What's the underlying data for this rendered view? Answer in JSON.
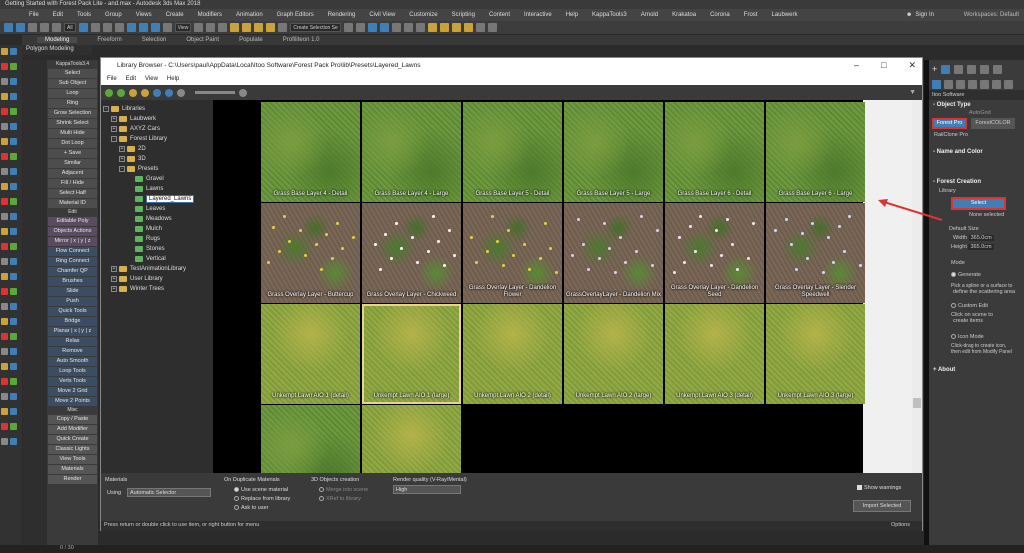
{
  "app": {
    "window_title": "Getting Started with Forest Pack Lite - and.max - Autodesk 3ds Max 2018",
    "menu": [
      "File",
      "Edit",
      "Tools",
      "Group",
      "Views",
      "Create",
      "Modifiers",
      "Animation",
      "Graph Editors",
      "Rendering",
      "Civil View",
      "Customize",
      "Scripting",
      "Content",
      "Interactive",
      "Help",
      "KappaTools3",
      "Arnold",
      "Krakatoa",
      "Corona",
      "Frost",
      "Laubwerk"
    ],
    "sign_in": "Sign In",
    "workspaces": "Workspaces: Default",
    "toolbar": {
      "filter": "All",
      "view": "View",
      "selection_set": "Create Selection Se"
    },
    "ribbon_tabs": [
      "Modeling",
      "Freeform",
      "Selection",
      "Object Paint",
      "Populate",
      "Profiliteon 1.0"
    ],
    "poly_tab": "Polygon Modeling"
  },
  "kappa": {
    "title": "KappaTools3.4",
    "buttons": [
      "Select",
      "Sub Object",
      "Loop",
      "Ring",
      "Grow Selection",
      "Shrink Select",
      "Multi Hide",
      "Dot Loop",
      "+ Save",
      "Similar",
      "Adjacent",
      "Fill / Hide",
      "Select Half",
      "Material ID",
      "Edit",
      "Editable Poly",
      "Objects Actions",
      "Mirror | x | y | z",
      "Flow Connect",
      "Ring Connect",
      "Chamfer QP",
      "Brushes",
      "Slide",
      "Push",
      "Quick Tools",
      "Bridge",
      "Planar | x | y | z",
      "Relax",
      "Remove",
      "Auto Smooth",
      "Loop Tools",
      "Verts Tools",
      "Move 2 Grid",
      "Move 2 Points",
      "Misc",
      "Copy / Paste",
      "Add Modifier",
      "Quick Create",
      "Classic Lights",
      "View Tools",
      "Materials",
      "Render"
    ]
  },
  "library": {
    "title": "Library Browser - C:\\Users\\paul\\AppData\\Local\\Itoo Software\\Forest Pack Pro\\lib\\Presets\\Layered_Lawns",
    "menu": [
      "File",
      "Edit",
      "View",
      "Help"
    ],
    "tree": {
      "root": "Libraries",
      "items": [
        "Laubwerk",
        "AXYZ Cars",
        "Forest Library",
        "2D",
        "3D",
        "Presets",
        "Gravel",
        "Lawns",
        "Layered_Lawns",
        "Leaves",
        "Meadows",
        "Mulch",
        "Rugs",
        "Stones",
        "Vertical",
        "TestAnimationLibrary",
        "User Library",
        "Winter Trees"
      ]
    },
    "tiles": [
      "Grass Base Layer 4 - Detail",
      "Grass Base Layer 4 - Large",
      "Grass Base Layer 5 - Detail",
      "Grass Base Layer 5 - Large",
      "Grass Base Layer 6 - Detail",
      "Grass Base Layer 6 - Large",
      "Grass Overlay Layer - Buttercup",
      "Grass Overlay Layer - Chickweed",
      "Grass Overlay Layer - Dandelion Flower",
      "GrassOverlayLayer - Dandelion Mix",
      "Grass Overlay Layer - Dandelion Seed",
      "Grass Overlay Layer - Slender Speedwell",
      "Unkempt Lawn AIO 1 (detail)",
      "Unkempt Lawn AIO 1 (large)",
      "Unkempt Lawn AIO 2 (detail)",
      "Unkempt Lawn AIO 2 (large)",
      "Unkempt Lawn AIO 3 (detail)",
      "Unkempt Lawn AIO 3 (large)",
      "",
      ""
    ],
    "materials": {
      "label": "Materials",
      "using_label": "Using",
      "using_value": "Automatic Selector"
    },
    "duplicate": {
      "label": "On Duplicate Materials",
      "options": [
        "Use scene material",
        "Replace from library",
        "Ask to user"
      ]
    },
    "objects3d": {
      "label": "3D Objects creation",
      "options": [
        "Merge into scene",
        "XRef to library"
      ]
    },
    "render_quality": {
      "label": "Render quality (V-Ray/Mental)",
      "value": "High"
    },
    "show_warnings": "Show warnings",
    "import_button": "Import Selected",
    "status": "Press return or double click to use item, or right button for menu",
    "options": "Options"
  },
  "right_panel": {
    "vendor": "Itoo Software",
    "object_type": "Object Type",
    "autogrid": "AutoGrid",
    "btn_forest_pro": "Forest Pro",
    "btn_forest_color": "ForestCOLOR",
    "btn_railclone": "RailClone Pro",
    "name_color": "Name and Color",
    "forest_creation": "Forest Creation",
    "library": "Library",
    "select": "Select",
    "none_selected": "None selected",
    "default_size": "Default Size",
    "width_label": "Width",
    "width_value": "365.0cm",
    "height_label": "Height",
    "height_value": "365.0cm",
    "mode": "Mode",
    "generate": "Generate",
    "pick_spline": "Pick a spline or a surface to",
    "define_area": "define the scattering area",
    "custom_edit": "Custom Edit",
    "click_on_scene": "Click on scene to",
    "create_items": "create items",
    "icon_mode": "Icon Mode",
    "click_to_create": "Click-drag to create icon,",
    "then_edit": "then edit from Modify Panel",
    "about": "About"
  },
  "timeline": {
    "frame": "0 / 30"
  }
}
